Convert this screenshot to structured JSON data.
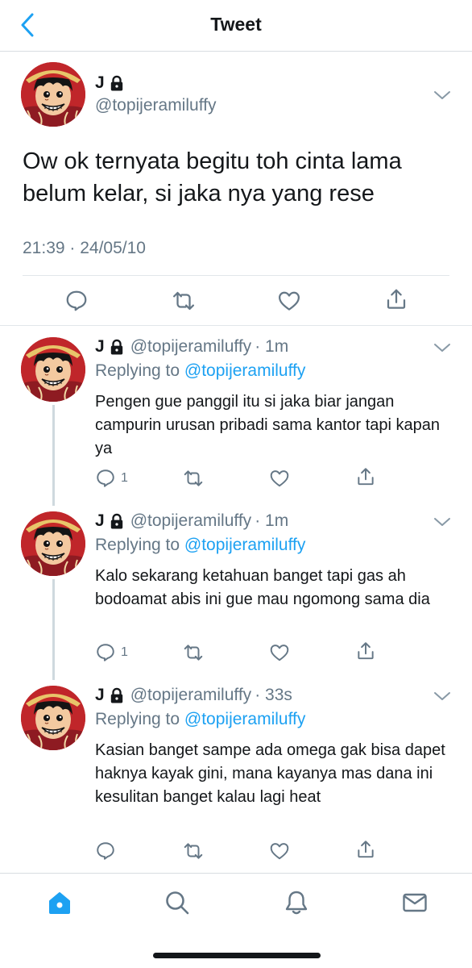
{
  "header": {
    "title": "Tweet",
    "back_icon": "chevron-left-icon"
  },
  "colors": {
    "accent": "#1da1f2",
    "muted": "#657786",
    "text": "#14171a",
    "divider": "#e1e6ea"
  },
  "main_tweet": {
    "name": "J",
    "handle": "@topijeramiluffy",
    "text": "Ow ok ternyata begitu toh cinta lama belum kelar, si jaka nya yang rese",
    "timestamp": "21:39 · 24/05/10"
  },
  "replies": [
    {
      "name": "J",
      "handle": "@topijeramiluffy",
      "time": "· 1m",
      "replying_prefix": "Replying to",
      "replying_to": "@topijeramiluffy",
      "text": "Pengen gue panggil itu si jaka biar jangan campurin urusan pribadi sama kantor tapi kapan ya",
      "reply_count": "1"
    },
    {
      "name": "J",
      "handle": "@topijeramiluffy",
      "time": "· 1m",
      "replying_prefix": "Replying to",
      "replying_to": "@topijeramiluffy",
      "text": "Kalo sekarang ketahuan banget tapi gas ah bodoamat abis ini gue mau ngomong sama dia",
      "reply_count": "1"
    },
    {
      "name": "J",
      "handle": "@topijeramiluffy",
      "time": "· 33s",
      "replying_prefix": "Replying to",
      "replying_to": "@topijeramiluffy",
      "text": "Kasian banget sampe ada omega gak bisa dapet haknya kayak gini, mana kayanya mas dana ini kesulitan banget kalau lagi heat",
      "reply_count": ""
    }
  ],
  "tabbar": {
    "items": [
      {
        "icon": "home-icon",
        "active": true
      },
      {
        "icon": "search-icon",
        "active": false
      },
      {
        "icon": "bell-icon",
        "active": false
      },
      {
        "icon": "mail-icon",
        "active": false
      }
    ]
  }
}
